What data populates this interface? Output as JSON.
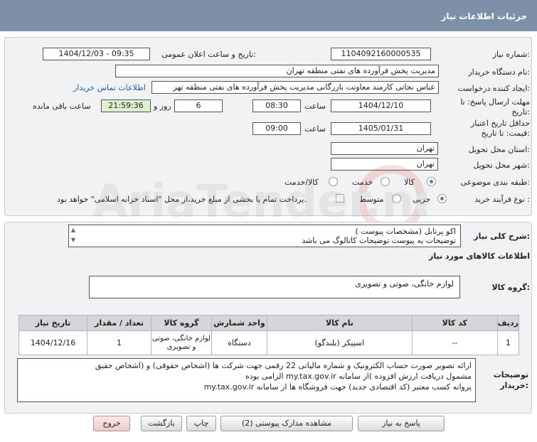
{
  "header": {
    "title": "جزئيات اطلاعات نياز"
  },
  "form": {
    "need_number_label": "شماره نياز:",
    "need_number": "1104092160000535",
    "announce_label": "تاريخ و ساعت اعلان عمومی:",
    "announce_value": "1404/12/03 - 09:35",
    "buyer_org_label": "نام دستگاه خريدار:",
    "buyer_org": "مديريت پخش فرآورده های نفتی منطقه تهران",
    "creator_label": "ايجاد کننده درخواست:",
    "creator": "عباس نجاتی کارمند معاونت بازرگانی مديريت پخش فرآورده های نفتی منطقه تهر",
    "contact_link": "اطلاعات تماس خريدار",
    "deadline_label": "مهلت ارسال پاسخ: تا تاريخ:",
    "deadline_date": "1404/12/10",
    "time_label": "ساعت",
    "deadline_time": "08:30",
    "days": "6",
    "days_label": "روز و",
    "remaining": "21:59:36",
    "remaining_label": "ساعت باقی مانده",
    "validity_label": "حداقل تاريخ اعتبار قيمت: تا تاريخ:",
    "validity_date": "1405/01/31",
    "validity_time": "09:00",
    "province_label": "استان محل تحويل:",
    "province": "تهران",
    "city_label": "شهر محل تحويل:",
    "city": "تهران",
    "category_label": "طبقه بندی موضوعی:",
    "category_options": [
      "کالا",
      "خدمت",
      "کالا/خدمت"
    ],
    "category_selected": "کالا",
    "process_label": "نوع فرآيند خريد :",
    "process_options": [
      "جزيی",
      "متوسط"
    ],
    "process_note": "پرداخت تمام يا بخشی از مبلغ خريد،از محل \"اسناد خزانه اسلامی\" خواهد بود."
  },
  "description": {
    "label": "شرح کلی نياز:",
    "line1": "اکو پرتابل (مشخصات پيوست )",
    "line2": "توضيحات به پيوست توضيحات کاتالوگ می باشد"
  },
  "goods": {
    "section_title": "اطلاعات کالاهای مورد نياز",
    "group_label": "گروه کالا:",
    "group_value": "لوازم خانگی، صوتی و تصويری",
    "columns": [
      "رديف",
      "کد کالا",
      "نام کالا",
      "واحد شمارش",
      "گروه کالا",
      "تعداد / مقدار",
      "تاريخ نياز"
    ],
    "rows": [
      {
        "row": "1",
        "code": "--",
        "name": "اسپيکر (بلندگو)",
        "unit": "دستگاه",
        "group": "لوازم خانگی، صوتی و تصويری",
        "qty": "1",
        "date": "1404/12/16"
      }
    ]
  },
  "buyer_notes": {
    "label": "توضيحات خريدار:",
    "line1": "ارائه  تصوير صورت حساب الکترونيک و شماره مالياتی 22 رقمی  جهت شرکت ها (اشخاص حقوقی) و (اشخاص حقيق",
    "line2": "مشمول دريافت ارزش افزوده )از سامانه my.tax.gov.ir  الزامی بوده",
    "line3": "پروانه کسب معتبر (کد اقتصادی جديد) جهت فروشگاه ها از سامانه my.tax.gov.ir"
  },
  "buttons": {
    "reply": "پاسخ به نياز",
    "docs": "مشاهده مدارک پيوستی (2)",
    "print": "چاپ",
    "back": "بازگشت",
    "exit": "خروج"
  },
  "watermark_text": "AriaTender.net"
}
